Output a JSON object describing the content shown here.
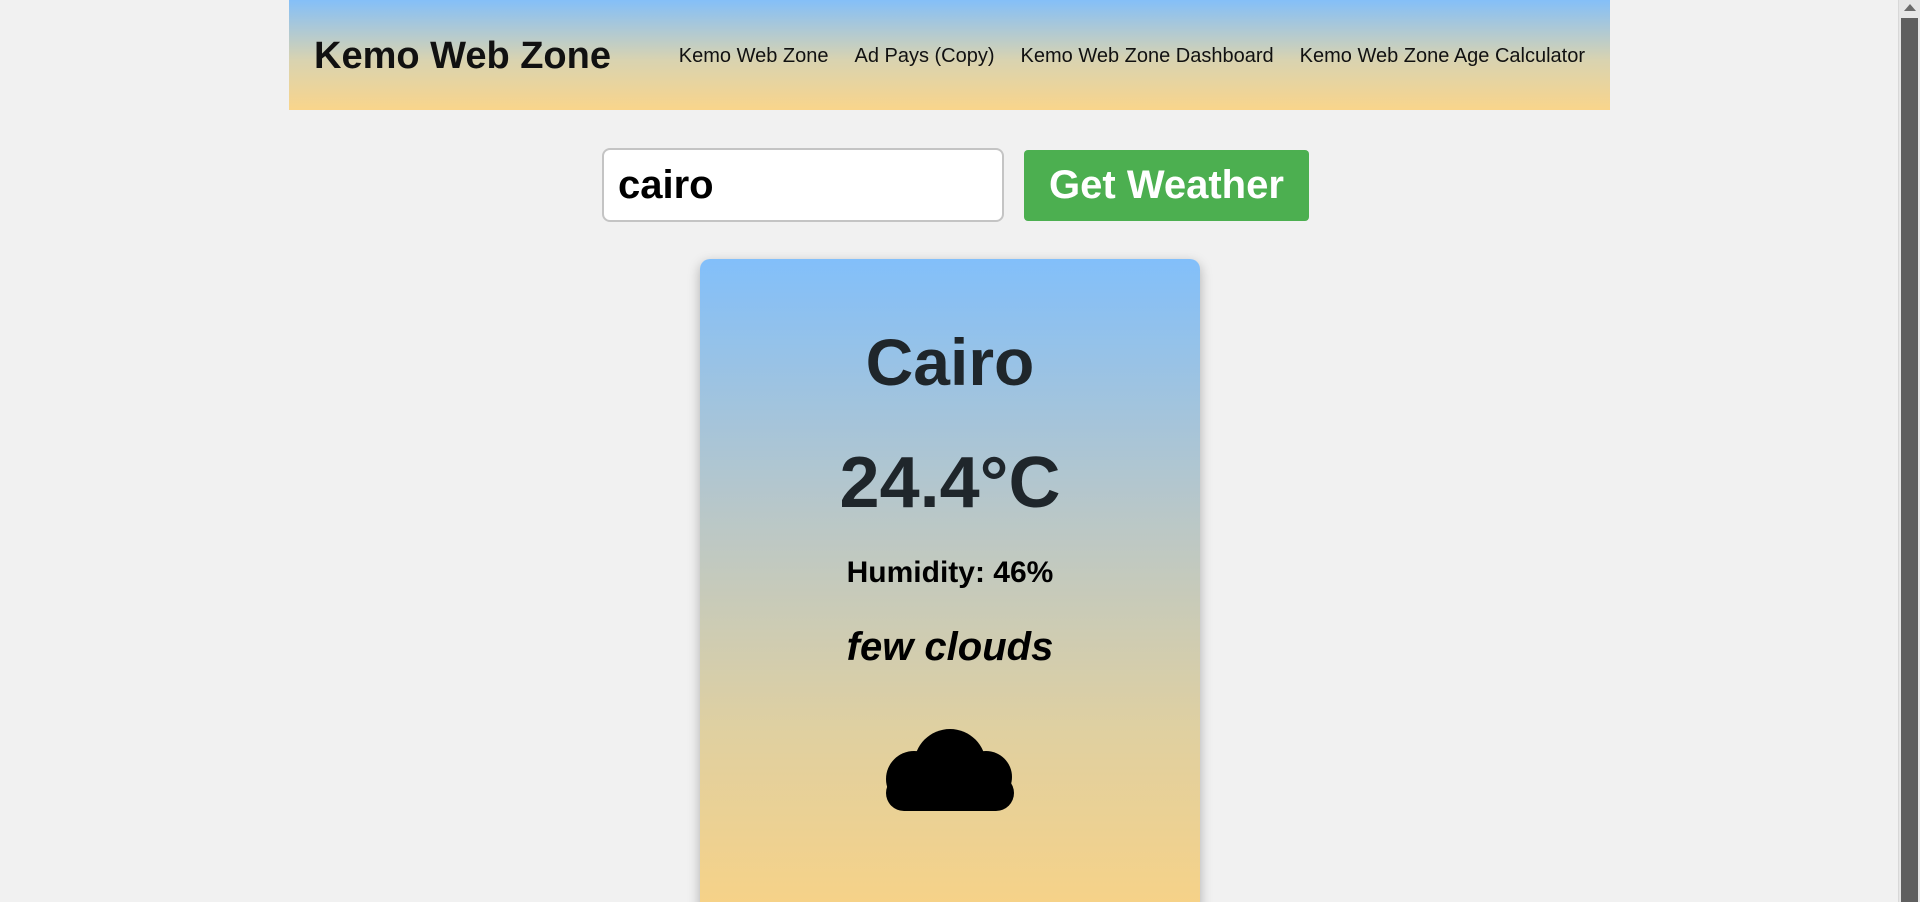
{
  "header": {
    "brand": "Kemo Web Zone",
    "nav": [
      {
        "label": "Kemo Web Zone"
      },
      {
        "label": "Ad Pays (Copy)"
      },
      {
        "label": "Kemo Web Zone Dashboard"
      },
      {
        "label": "Kemo Web Zone Age Calculator"
      }
    ]
  },
  "search": {
    "value": "cairo",
    "button_label": "Get Weather"
  },
  "weather": {
    "city": "Cairo",
    "temperature": "24.4°C",
    "humidity": "Humidity: 46%",
    "description": "few clouds",
    "icon": "cloud-icon"
  },
  "colors": {
    "button": "#4caf50",
    "header_top": "#84bff8",
    "header_bottom": "#f9d58b",
    "card_top": "#82bffa",
    "card_bottom": "#f8d286"
  }
}
